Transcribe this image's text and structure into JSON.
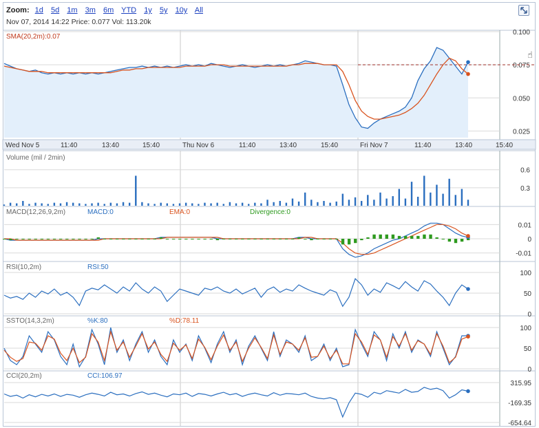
{
  "toolbar": {
    "zoom_label": "Zoom:",
    "zoom_options": [
      "1d",
      "5d",
      "1m",
      "3m",
      "6m",
      "YTD",
      "1y",
      "5y",
      "10y",
      "All"
    ]
  },
  "info_line": "Nov 07, 2014 14:22 Price: 0.077 Vol: 113.20k",
  "colors": {
    "blue": "#2a6ebf",
    "orange": "#d9531e",
    "green": "#2e9a1f",
    "fill": "#e3effb",
    "grid": "#d9d9d9"
  },
  "chart_data": [
    {
      "type": "line",
      "panel": "price",
      "title": "SMA(20,2m):0.07",
      "x_tick_labels": [
        "Wed Nov 5",
        "11:40",
        "13:40",
        "15:40",
        "Thu Nov 6",
        "11:40",
        "13:40",
        "15:40",
        "Fri Nov 7",
        "11:40",
        "13:40",
        "15:40"
      ],
      "y_ticks": [
        "0.100",
        "0.075",
        "0.050",
        "0.025"
      ],
      "ylim": [
        0.02,
        0.1
      ],
      "reference_line": 0.075,
      "series": [
        {
          "name": "Price",
          "color": "#2a6ebf",
          "values": [
            0.076,
            0.074,
            0.072,
            0.071,
            0.07,
            0.071,
            0.069,
            0.068,
            0.069,
            0.068,
            0.069,
            0.068,
            0.069,
            0.068,
            0.069,
            0.068,
            0.069,
            0.07,
            0.071,
            0.072,
            0.073,
            0.073,
            0.074,
            0.073,
            0.074,
            0.073,
            0.074,
            0.073,
            0.074,
            0.075,
            0.074,
            0.075,
            0.074,
            0.076,
            0.075,
            0.074,
            0.073,
            0.074,
            0.075,
            0.074,
            0.073,
            0.074,
            0.075,
            0.074,
            0.075,
            0.074,
            0.075,
            0.076,
            0.078,
            0.077,
            0.076,
            0.075,
            0.075,
            0.074,
            0.06,
            0.045,
            0.035,
            0.028,
            0.027,
            0.031,
            0.034,
            0.036,
            0.038,
            0.04,
            0.043,
            0.05,
            0.063,
            0.072,
            0.078,
            0.088,
            0.086,
            0.08,
            0.074,
            0.068,
            0.077
          ]
        },
        {
          "name": "SMA",
          "color": "#d9531e",
          "values": [
            0.074,
            0.073,
            0.072,
            0.071,
            0.07,
            0.07,
            0.07,
            0.069,
            0.069,
            0.069,
            0.069,
            0.069,
            0.069,
            0.069,
            0.069,
            0.069,
            0.069,
            0.069,
            0.07,
            0.071,
            0.071,
            0.072,
            0.072,
            0.073,
            0.073,
            0.073,
            0.073,
            0.073,
            0.073,
            0.074,
            0.074,
            0.074,
            0.074,
            0.075,
            0.075,
            0.075,
            0.074,
            0.074,
            0.074,
            0.074,
            0.074,
            0.074,
            0.074,
            0.074,
            0.074,
            0.074,
            0.075,
            0.075,
            0.076,
            0.076,
            0.076,
            0.075,
            0.075,
            0.075,
            0.07,
            0.06,
            0.048,
            0.04,
            0.036,
            0.034,
            0.034,
            0.035,
            0.036,
            0.037,
            0.039,
            0.042,
            0.046,
            0.052,
            0.06,
            0.068,
            0.075,
            0.08,
            0.078,
            0.072,
            0.068
          ]
        }
      ]
    },
    {
      "type": "bar",
      "panel": "volume",
      "title": "Volume (mil / 2min)",
      "y_ticks": [
        "0.6",
        "0.3"
      ],
      "ylim": [
        0,
        0.7
      ],
      "values": [
        0.02,
        0.05,
        0.04,
        0.08,
        0.03,
        0.05,
        0.04,
        0.03,
        0.05,
        0.04,
        0.06,
        0.05,
        0.04,
        0.03,
        0.04,
        0.05,
        0.03,
        0.05,
        0.04,
        0.06,
        0.05,
        0.5,
        0.06,
        0.04,
        0.03,
        0.05,
        0.04,
        0.03,
        0.04,
        0.05,
        0.04,
        0.03,
        0.05,
        0.04,
        0.05,
        0.03,
        0.06,
        0.04,
        0.05,
        0.03,
        0.05,
        0.04,
        0.1,
        0.06,
        0.08,
        0.05,
        0.12,
        0.07,
        0.22,
        0.1,
        0.06,
        0.08,
        0.05,
        0.07,
        0.2,
        0.1,
        0.14,
        0.08,
        0.18,
        0.1,
        0.22,
        0.12,
        0.16,
        0.28,
        0.12,
        0.4,
        0.15,
        0.5,
        0.22,
        0.35,
        0.2,
        0.45,
        0.18,
        0.28,
        0.1
      ]
    },
    {
      "type": "line",
      "panel": "macd",
      "title": "MACD(12,26,9,2m)",
      "legend": [
        "MACD:0",
        "EMA:0",
        "Divergence:0"
      ],
      "y_ticks": [
        "0.01",
        "0",
        "-0.01"
      ],
      "ylim": [
        -0.015,
        0.015
      ],
      "series": [
        {
          "name": "MACD",
          "color": "#2a6ebf",
          "values": [
            0.0,
            -0.001,
            -0.001,
            -0.001,
            -0.001,
            -0.001,
            -0.001,
            -0.001,
            -0.001,
            -0.001,
            -0.001,
            -0.001,
            -0.001,
            -0.001,
            -0.001,
            0.0,
            0.0,
            0.0,
            0.0,
            0.0,
            0.0,
            0.0,
            0.0,
            0.0,
            0.0,
            0.001,
            0.001,
            0.001,
            0.001,
            0.001,
            0.001,
            0.001,
            0.001,
            0.001,
            0.0,
            0.0,
            0.0,
            0.0,
            0.0,
            0.0,
            0.0,
            0.0,
            0.0,
            0.0,
            0.0,
            0.0,
            0.0,
            0.001,
            0.001,
            0.0,
            0.0,
            0.0,
            0.0,
            0.0,
            -0.007,
            -0.011,
            -0.013,
            -0.012,
            -0.01,
            -0.007,
            -0.005,
            -0.003,
            -0.001,
            0.0,
            0.002,
            0.004,
            0.006,
            0.009,
            0.011,
            0.011,
            0.01,
            0.007,
            0.004,
            0.002,
            0.001
          ]
        },
        {
          "name": "EMA",
          "color": "#d9531e",
          "values": [
            0.0,
            0.0,
            -0.001,
            -0.001,
            -0.001,
            -0.001,
            -0.001,
            -0.001,
            -0.001,
            -0.001,
            -0.001,
            -0.001,
            -0.001,
            -0.001,
            -0.001,
            -0.001,
            0.0,
            0.0,
            0.0,
            0.0,
            0.0,
            0.0,
            0.0,
            0.0,
            0.0,
            0.0,
            0.001,
            0.001,
            0.001,
            0.001,
            0.001,
            0.001,
            0.001,
            0.001,
            0.001,
            0.0,
            0.0,
            0.0,
            0.0,
            0.0,
            0.0,
            0.0,
            0.0,
            0.0,
            0.0,
            0.0,
            0.0,
            0.0,
            0.001,
            0.001,
            0.0,
            0.0,
            0.0,
            0.0,
            -0.003,
            -0.007,
            -0.01,
            -0.011,
            -0.011,
            -0.01,
            -0.008,
            -0.006,
            -0.004,
            -0.002,
            0.0,
            0.002,
            0.004,
            0.006,
            0.008,
            0.01,
            0.01,
            0.009,
            0.007,
            0.004,
            0.002
          ]
        },
        {
          "name": "Divergence",
          "color": "#2e9a1f",
          "values": [
            0.0,
            -0.001,
            0.0,
            0.0,
            0.0,
            0.0,
            0.0,
            0.0,
            0.0,
            0.0,
            0.0,
            0.0,
            0.0,
            0.0,
            0.0,
            0.001,
            0.0,
            0.0,
            0.0,
            0.0,
            0.0,
            0.0,
            0.0,
            0.0,
            0.0,
            0.001,
            0.0,
            0.0,
            0.0,
            0.0,
            0.0,
            0.0,
            0.0,
            0.0,
            -0.001,
            0.0,
            0.0,
            0.0,
            0.0,
            0.0,
            0.0,
            0.0,
            0.0,
            0.0,
            0.0,
            0.0,
            0.0,
            0.001,
            0.0,
            -0.001,
            0.0,
            0.0,
            0.0,
            0.0,
            -0.004,
            -0.004,
            -0.003,
            -0.001,
            0.001,
            0.003,
            0.003,
            0.003,
            0.003,
            0.002,
            0.002,
            0.002,
            0.002,
            0.003,
            0.003,
            0.001,
            0.0,
            -0.002,
            -0.003,
            -0.002,
            -0.001
          ]
        }
      ]
    },
    {
      "type": "line",
      "panel": "rsi",
      "title": "RSI(10,2m)",
      "legend": [
        "RSI:50"
      ],
      "y_ticks": [
        "100",
        "50",
        "0"
      ],
      "ylim": [
        0,
        100
      ],
      "series": [
        {
          "name": "RSI",
          "color": "#2a6ebf",
          "values": [
            45,
            38,
            42,
            35,
            50,
            40,
            55,
            48,
            60,
            45,
            52,
            40,
            20,
            55,
            62,
            58,
            70,
            60,
            50,
            65,
            55,
            75,
            60,
            50,
            65,
            55,
            30,
            45,
            60,
            55,
            50,
            45,
            62,
            58,
            65,
            55,
            50,
            60,
            48,
            55,
            62,
            40,
            58,
            65,
            52,
            60,
            55,
            70,
            62,
            55,
            50,
            45,
            58,
            52,
            18,
            40,
            85,
            70,
            45,
            60,
            52,
            75,
            68,
            60,
            78,
            65,
            55,
            80,
            72,
            55,
            40,
            20,
            50,
            70,
            60
          ]
        }
      ]
    },
    {
      "type": "line",
      "panel": "ssto",
      "title": "SSTO(14,3,2m)",
      "legend": [
        "%K:80",
        "%D:78.11"
      ],
      "y_ticks": [
        "100",
        "50",
        "0"
      ],
      "ylim": [
        0,
        100
      ],
      "series": [
        {
          "name": "%K",
          "color": "#2a6ebf",
          "values": [
            50,
            20,
            10,
            30,
            80,
            60,
            40,
            90,
            70,
            30,
            10,
            60,
            5,
            30,
            95,
            60,
            10,
            100,
            40,
            70,
            20,
            60,
            90,
            40,
            70,
            30,
            10,
            70,
            40,
            60,
            20,
            80,
            50,
            15,
            60,
            90,
            40,
            70,
            10,
            55,
            80,
            50,
            20,
            90,
            30,
            70,
            60,
            40,
            80,
            20,
            30,
            60,
            20,
            50,
            5,
            10,
            95,
            60,
            30,
            90,
            70,
            20,
            85,
            50,
            90,
            40,
            70,
            60,
            30,
            90,
            50,
            10,
            30,
            80,
            80
          ]
        },
        {
          "name": "%D",
          "color": "#d9531e",
          "values": [
            45,
            28,
            18,
            25,
            65,
            62,
            45,
            80,
            72,
            38,
            20,
            50,
            15,
            28,
            85,
            65,
            20,
            90,
            45,
            65,
            28,
            55,
            85,
            48,
            65,
            35,
            18,
            62,
            45,
            58,
            25,
            72,
            52,
            22,
            55,
            82,
            45,
            65,
            18,
            50,
            75,
            52,
            25,
            82,
            35,
            65,
            60,
            45,
            75,
            28,
            30,
            55,
            25,
            45,
            12,
            12,
            85,
            65,
            35,
            82,
            70,
            28,
            78,
            55,
            85,
            45,
            68,
            60,
            35,
            85,
            55,
            15,
            28,
            72,
            78
          ]
        }
      ]
    },
    {
      "type": "line",
      "panel": "cci",
      "title": "CCI(20,2m)",
      "legend": [
        "CCI:106.97"
      ],
      "y_ticks": [
        "315.95",
        "-169.35",
        "-654.64"
      ],
      "ylim": [
        -654.64,
        315.95
      ],
      "series": [
        {
          "name": "CCI",
          "color": "#2a6ebf",
          "values": [
            40,
            -20,
            10,
            -60,
            20,
            -30,
            30,
            -10,
            40,
            -20,
            30,
            10,
            -40,
            20,
            60,
            30,
            -10,
            80,
            20,
            40,
            -10,
            50,
            90,
            30,
            60,
            10,
            -30,
            40,
            20,
            60,
            -20,
            50,
            30,
            -10,
            40,
            80,
            20,
            50,
            -20,
            30,
            60,
            20,
            -10,
            70,
            10,
            50,
            40,
            20,
            60,
            -20,
            -60,
            -80,
            -50,
            -100,
            -520,
            -180,
            60,
            30,
            -40,
            80,
            40,
            120,
            90,
            60,
            150,
            80,
            100,
            200,
            150,
            180,
            120,
            -60,
            20,
            140,
            107
          ]
        }
      ]
    }
  ]
}
